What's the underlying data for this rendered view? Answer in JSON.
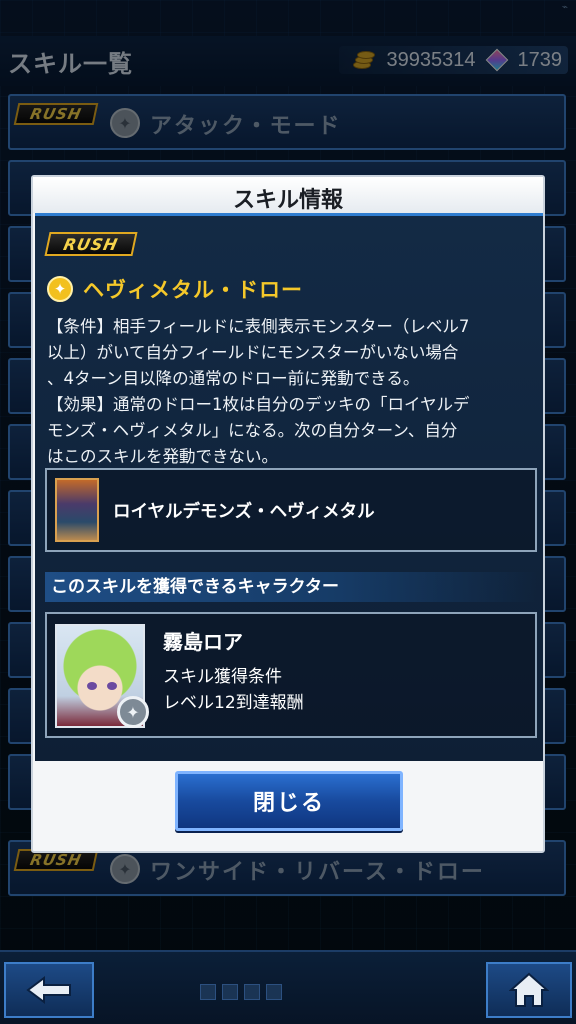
{
  "header": {
    "title": "スキル一覧",
    "coins": "39935314",
    "gems": "1739"
  },
  "skill_list": [
    {
      "badge": "RUSH",
      "name": "アタック・モード"
    },
    {
      "badge": "RUSH",
      "name": "ワンサイド・リバース・ドロー"
    }
  ],
  "modal": {
    "title": "スキル情報",
    "badge": "RUSH",
    "skill_name": "ヘヴィメタル・ドロー",
    "description": "【条件】相手フィールドに表側表示モンスター（レベル7\n以上）がいて自分フィールドにモンスターがいない場合\n、4ターン目以降の通常のドロー前に発動できる。\n【効果】通常のドロー1枚は自分のデッキの「ロイヤルデ\nモンズ・ヘヴィメタル」になる。次の自分ターン、自分\nはこのスキルを発動できない。",
    "card_name": "ロイヤルデモンズ・ヘヴィメタル",
    "character_section_label": "このスキルを獲得できるキャラクター",
    "character_name": "霧島ロア",
    "condition_label": "スキル獲得条件",
    "condition_value": "レベル12到達報酬",
    "close_label": "閉じる"
  },
  "icons": {
    "coin": "coin-stack-icon",
    "gem": "gem-icon",
    "skill_type": "star-skill-icon",
    "back": "back-arrow-icon",
    "home": "home-icon"
  },
  "colors": {
    "accent": "#2f7dd0",
    "skill_title": "#f5c82a",
    "rush_gold": "#e0a820"
  }
}
